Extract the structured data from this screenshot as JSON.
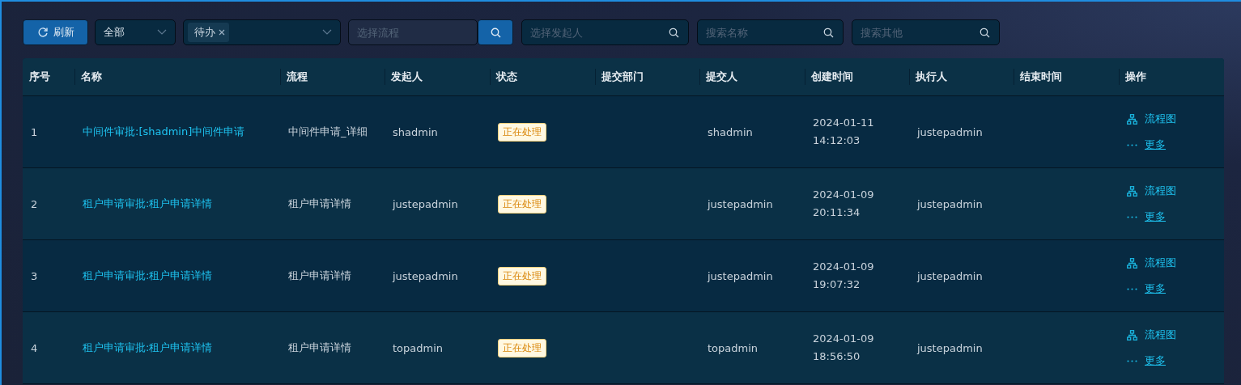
{
  "toolbar": {
    "refresh": "刷新",
    "scope_select": {
      "value": "全部"
    },
    "type_select": {
      "tags": [
        "待办"
      ]
    },
    "flow_field": {
      "placeholder": "选择流程"
    },
    "initiator_field": {
      "placeholder": "选择发起人"
    },
    "name_field": {
      "placeholder": "搜索名称"
    },
    "other_field": {
      "placeholder": "搜索其他"
    }
  },
  "table": {
    "columns": [
      "序号",
      "名称",
      "流程",
      "发起人",
      "状态",
      "提交部门",
      "提交人",
      "创建时间",
      "执行人",
      "结束时间",
      "操作"
    ],
    "rows": [
      {
        "index": "1",
        "name": "中间件审批:[shadmin]中间件申请",
        "flow": "中间件申请_详细",
        "initiator": "shadmin",
        "status": {
          "text": "正在处理",
          "kind": "processing"
        },
        "submitter": "shadmin",
        "created": [
          "2024-01-11",
          "14:12:03"
        ],
        "executor": "justepadmin",
        "actions": [
          "流程图",
          "更多"
        ]
      },
      {
        "index": "2",
        "name": "租户申请审批:租户申请详情",
        "flow": "租户申请详情",
        "initiator": "justepadmin",
        "status": {
          "text": "正在处理",
          "kind": "processing"
        },
        "submitter": "justepadmin",
        "created": [
          "2024-01-09",
          "20:11:34"
        ],
        "executor": "justepadmin",
        "actions": [
          "流程图",
          "更多"
        ]
      },
      {
        "index": "3",
        "name": "租户申请审批:租户申请详情",
        "flow": "租户申请详情",
        "initiator": "justepadmin",
        "status": {
          "text": "正在处理",
          "kind": "processing"
        },
        "submitter": "justepadmin",
        "created": [
          "2024-01-09",
          "19:07:32"
        ],
        "executor": "justepadmin",
        "actions": [
          "流程图",
          "更多"
        ]
      },
      {
        "index": "4",
        "name": "租户申请审批:租户申请详情",
        "flow": "租户申请详情",
        "initiator": "topadmin",
        "status": {
          "text": "正在处理",
          "kind": "processing"
        },
        "submitter": "topadmin",
        "created": [
          "2024-01-09",
          "18:56:50"
        ],
        "executor": "justepadmin",
        "actions": [
          "流程图",
          "更多"
        ]
      }
    ]
  }
}
